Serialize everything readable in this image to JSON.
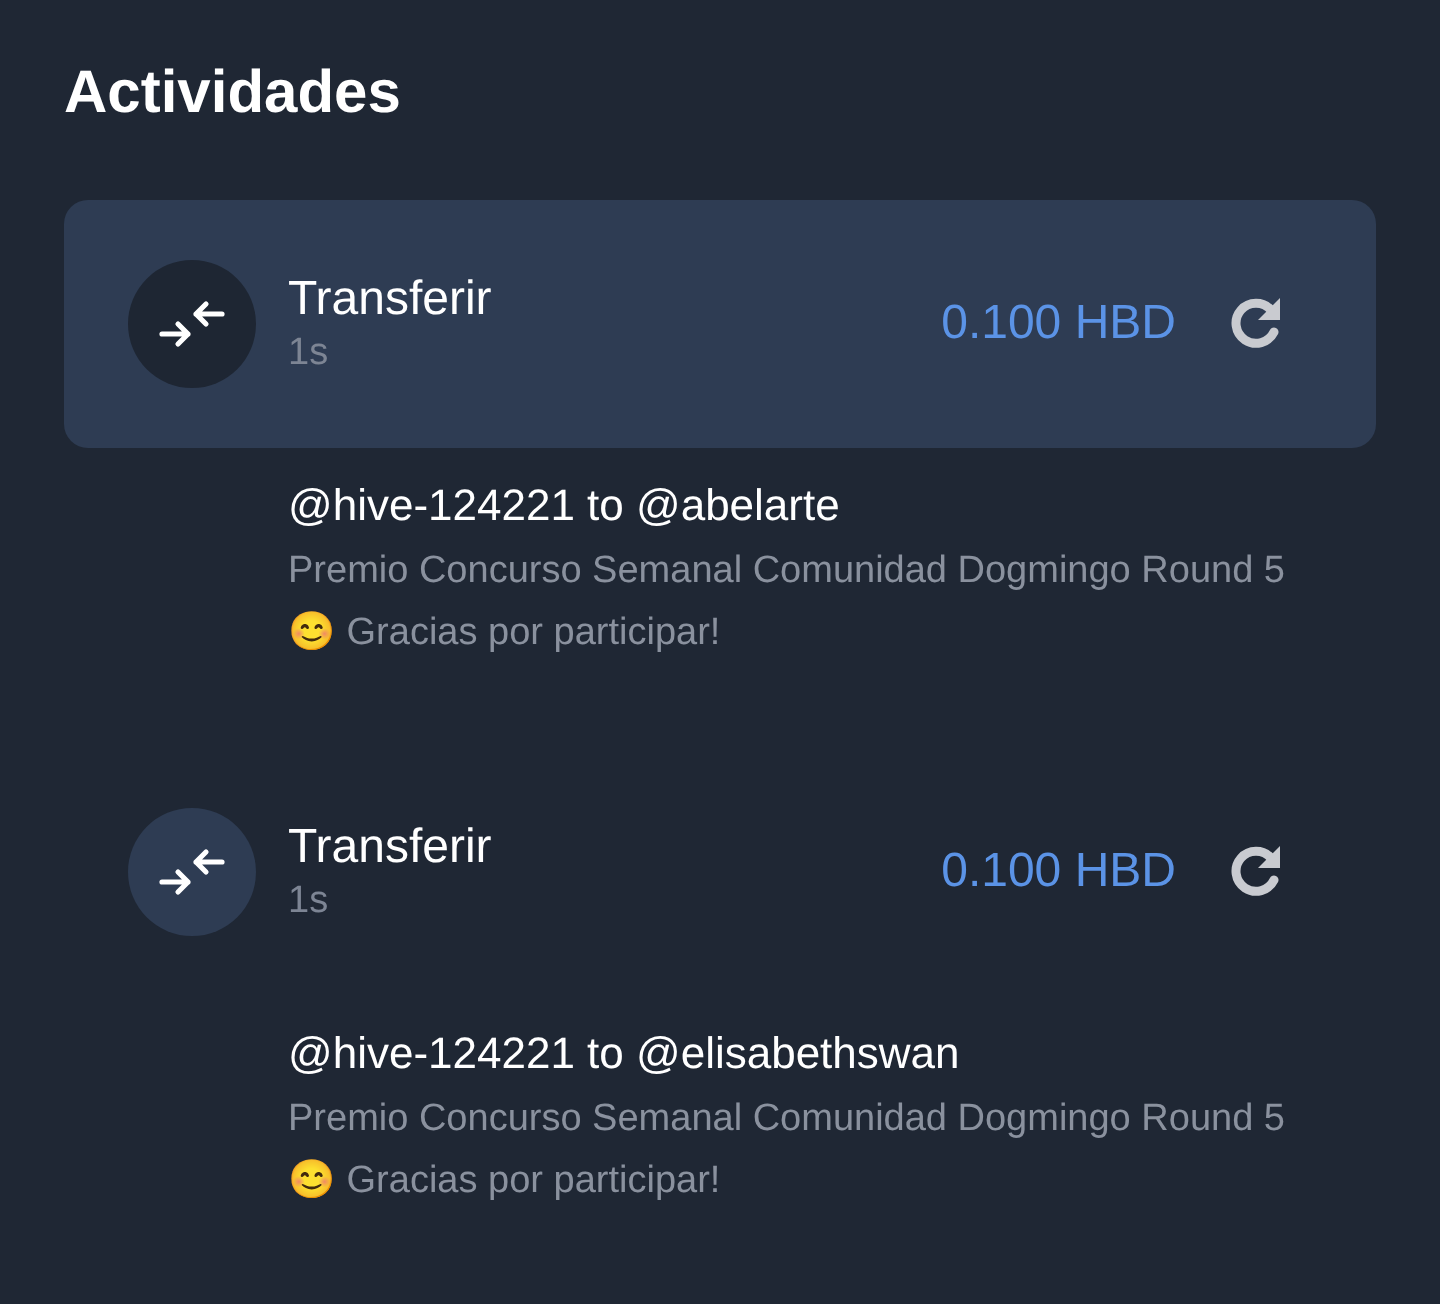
{
  "title": "Actividades",
  "activities": [
    {
      "type": "Transferir",
      "time": "1s",
      "amount": "0.100 HBD",
      "selected": true,
      "from_to": "@hive-124221 to @abelarte",
      "memo": "Premio Concurso Semanal Comunidad Dogmingo Round 5 😊 Gracias por participar!"
    },
    {
      "type": "Transferir",
      "time": "1s",
      "amount": "0.100 HBD",
      "selected": false,
      "from_to": "@hive-124221 to @elisabethswan",
      "memo": "Premio Concurso Semanal Comunidad Dogmingo Round 5 😊 Gracias por participar!"
    }
  ]
}
